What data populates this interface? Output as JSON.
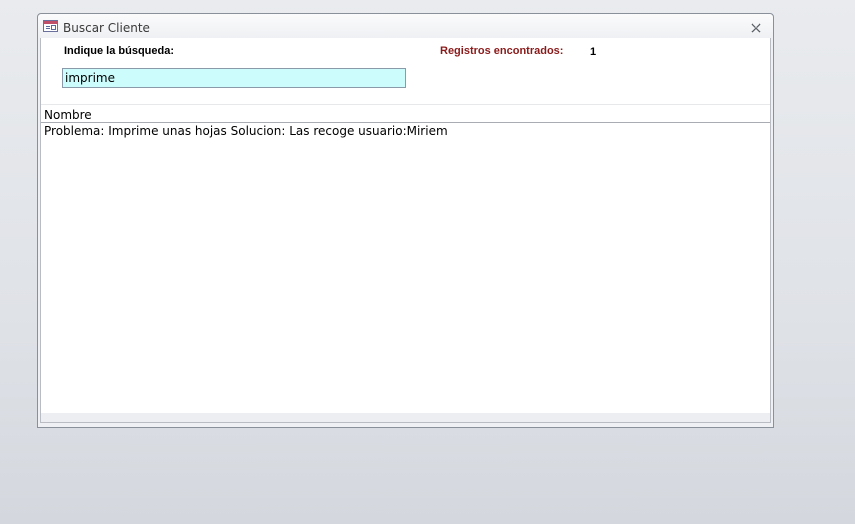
{
  "window": {
    "title": "Buscar Cliente"
  },
  "search": {
    "label": "Indique la búsqueda:",
    "value": "imprime"
  },
  "results": {
    "label": "Registros encontrados:",
    "count": "1"
  },
  "list": {
    "column_header": "Nombre",
    "items": [
      {
        "text": "Problema: Imprime unas hojas Solucion: Las recoge usuario:Miriem"
      }
    ]
  },
  "icons": {
    "form": "form-icon",
    "close": "close-icon"
  },
  "colors": {
    "input_background": "#ccfcfc",
    "results_label": "#8b1a1a"
  }
}
